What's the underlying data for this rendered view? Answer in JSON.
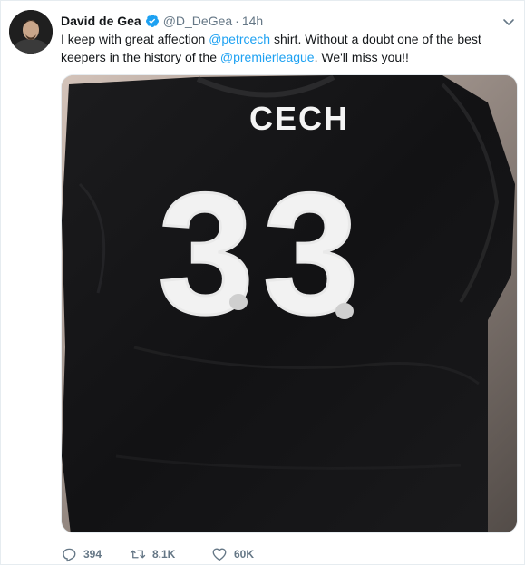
{
  "user": {
    "display_name": "David de Gea",
    "handle": "@D_DeGea",
    "separator": "·",
    "time": "14h",
    "verified": true,
    "avatar_icon": "profile-photo"
  },
  "tweet": {
    "text_part1": "I keep with great affection ",
    "mention1": "@petrcech",
    "text_part2": " shirt. Without a doubt one of the best",
    "text_part3": "keepers in the history of the ",
    "mention2": "@premierleague",
    "text_part4": ". We'll miss you!!"
  },
  "media": {
    "description_icon": "black-goalkeeper-shirt-photo",
    "shirt_name": "CECH",
    "shirt_number": "33"
  },
  "actions": {
    "reply_count": "394",
    "retweet_count": "8.1K",
    "like_count": "60K"
  },
  "colors": {
    "link": "#1da1f2",
    "muted": "#657786",
    "text": "#14171a",
    "verified": "#1da1f2"
  }
}
